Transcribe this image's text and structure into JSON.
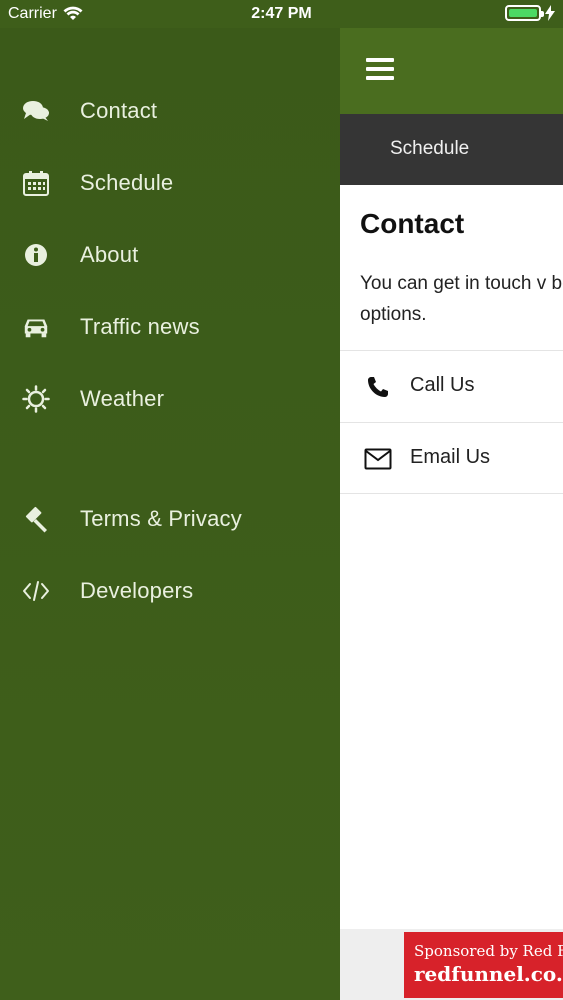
{
  "status_bar": {
    "carrier": "Carrier",
    "time": "2:47 PM",
    "battery_level": 1.0
  },
  "drawer": {
    "items": [
      {
        "label": "Contact",
        "icon": "chat-bubbles-icon"
      },
      {
        "label": "Schedule",
        "icon": "calendar-icon"
      },
      {
        "label": "About",
        "icon": "info-icon"
      },
      {
        "label": "Traffic news",
        "icon": "car-icon"
      },
      {
        "label": "Weather",
        "icon": "sun-icon"
      },
      {
        "label": "Terms & Privacy",
        "icon": "gavel-icon"
      },
      {
        "label": "Developers",
        "icon": "code-icon"
      }
    ]
  },
  "header": {
    "menu_icon": "hamburger-menu-icon",
    "tab_label": "Schedule"
  },
  "content": {
    "title": "Contact",
    "description": "You can get in touch v below options.",
    "options": [
      {
        "label": "Call Us",
        "icon": "phone-icon"
      },
      {
        "label": "Email Us",
        "icon": "envelope-icon"
      }
    ]
  },
  "ad": {
    "line1": "Sponsored by Red Fu",
    "line2": "redfunnel.co.u"
  },
  "colors": {
    "drawer_bg": "#3d5d1a",
    "topbar_bg": "#4a6d1f",
    "tabbar_bg": "#353535",
    "ad_bg": "#d7222a"
  }
}
